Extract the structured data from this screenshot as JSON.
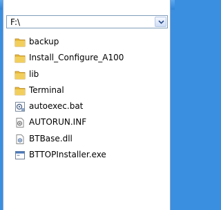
{
  "path_combo": {
    "value": "F:\\"
  },
  "items": [
    {
      "label": "backup",
      "icon": "folder-icon"
    },
    {
      "label": "Install_Configure_A100",
      "icon": "folder-icon"
    },
    {
      "label": "lib",
      "icon": "folder-icon"
    },
    {
      "label": "Terminal",
      "icon": "folder-icon"
    },
    {
      "label": "autoexec.bat",
      "icon": "batch-file-icon"
    },
    {
      "label": "AUTORUN.INF",
      "icon": "settings-file-icon"
    },
    {
      "label": "BTBase.dll",
      "icon": "dll-file-icon"
    },
    {
      "label": "BTTOPInstaller.exe",
      "icon": "exe-file-icon"
    }
  ],
  "colors": {
    "folder": "#e7b93a",
    "selection_bar": "#3a8fe0"
  }
}
